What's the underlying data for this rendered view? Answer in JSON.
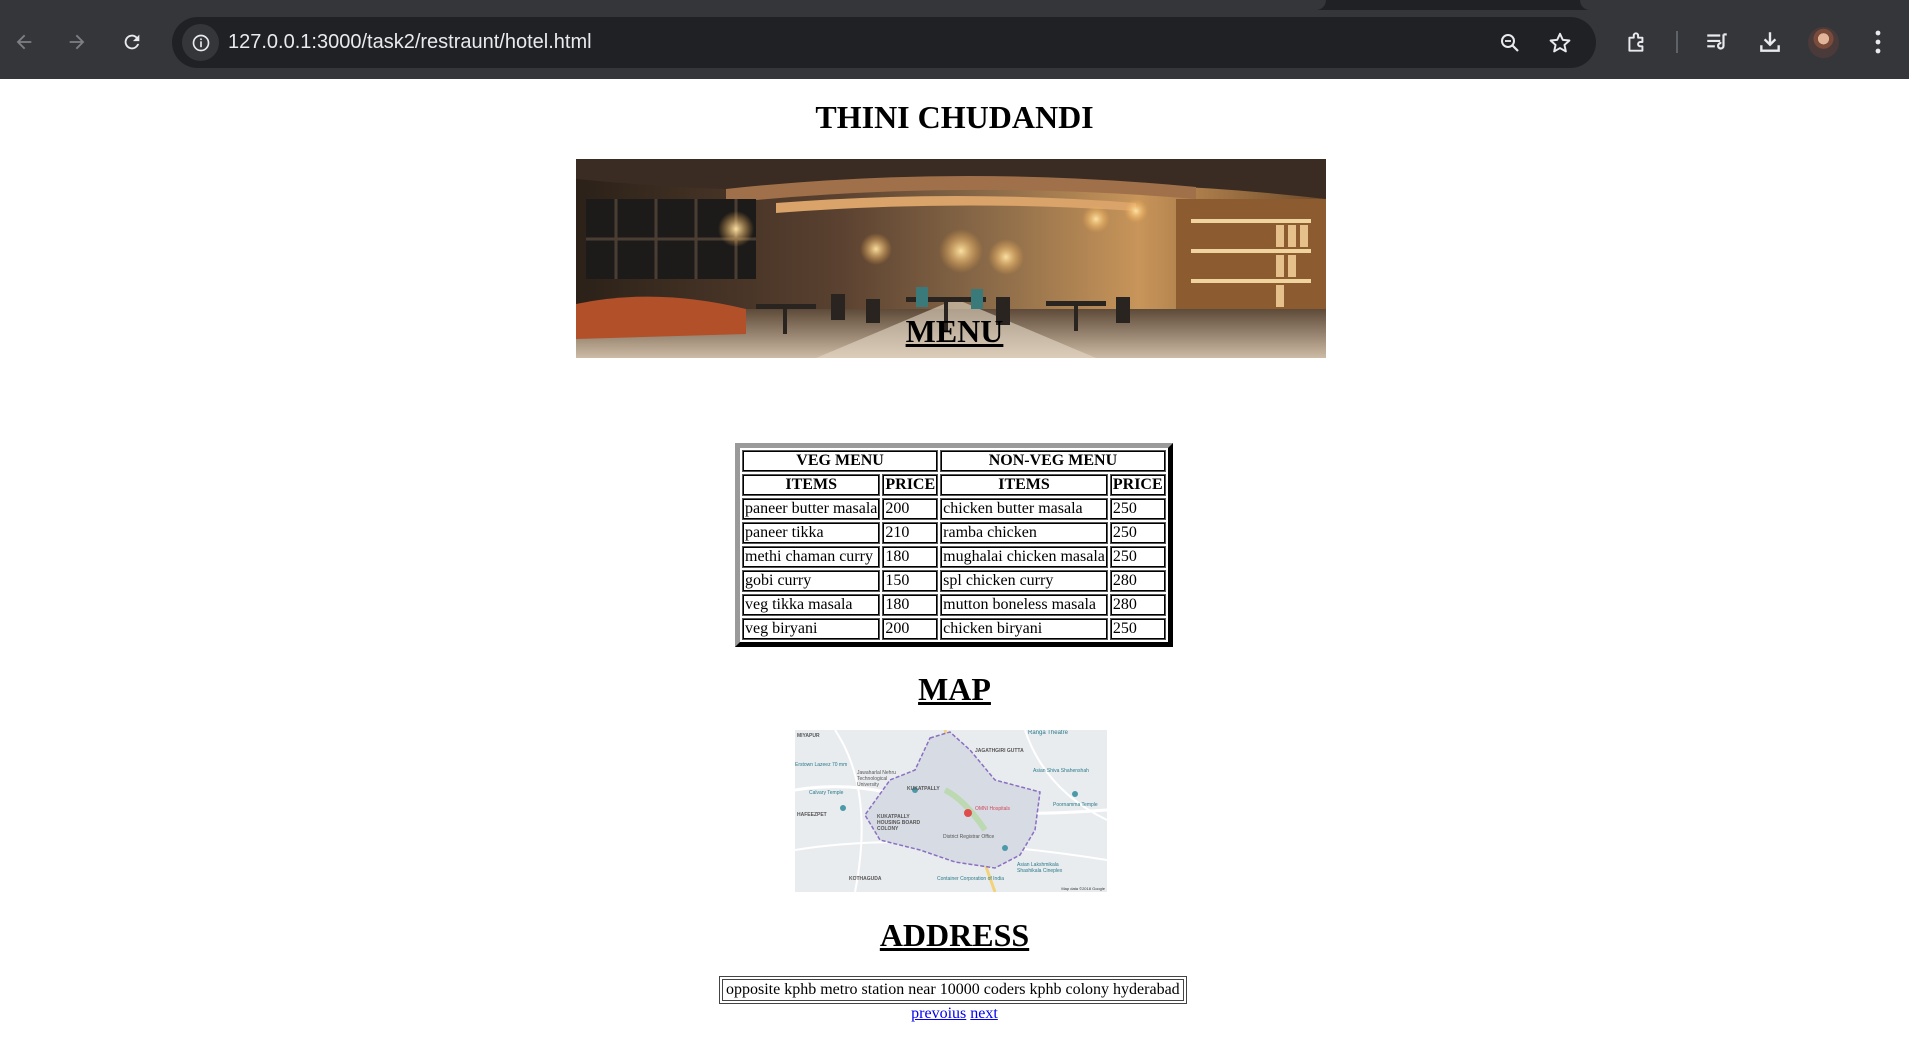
{
  "browser": {
    "url": "127.0.0.1:3000/task2/restraunt/hotel.html",
    "icons": [
      "back-arrow-icon",
      "forward-arrow-icon",
      "reload-icon",
      "site-info-icon",
      "zoom-icon",
      "bookmark-star-icon",
      "extensions-icon",
      "tab-search-icon",
      "download-icon",
      "avatar",
      "more-menu-icon"
    ]
  },
  "page": {
    "title": "THINI CHUDANDI",
    "menu_heading": "MENU",
    "map_heading": "MAP",
    "address_heading": "ADDRESS"
  },
  "menu": {
    "groups": [
      "VEG MENU",
      "NON-VEG MENU"
    ],
    "columns": [
      "ITEMS",
      "PRICE",
      "ITEMS",
      "PRICE"
    ],
    "rows": [
      {
        "veg_item": "paneer butter masala",
        "veg_price": "200",
        "nonveg_item": "chicken butter masala",
        "nonveg_price": "250"
      },
      {
        "veg_item": "paneer tikka",
        "veg_price": "210",
        "nonveg_item": "ramba chicken",
        "nonveg_price": "250"
      },
      {
        "veg_item": "methi chaman curry",
        "veg_price": "180",
        "nonveg_item": "mughalai chicken masala",
        "nonveg_price": "250"
      },
      {
        "veg_item": "gobi curry",
        "veg_price": "150",
        "nonveg_item": "spl chicken curry",
        "nonveg_price": "280"
      },
      {
        "veg_item": "veg tikka masala",
        "veg_price": "180",
        "nonveg_item": "mutton boneless masala",
        "nonveg_price": "280"
      },
      {
        "veg_item": "veg biryani",
        "veg_price": "200",
        "nonveg_item": "chicken biryani",
        "nonveg_price": "250"
      }
    ]
  },
  "map": {
    "labels": {
      "miyapur": "MIYAPUR",
      "jagathgiri": "JAGATHGIRI GUTTA",
      "ranga_theatre": "Ranga Theatre",
      "lazeez": "Erstown Lazeez 70 mm",
      "jntu": "Jawaharlal Nehru Technological University",
      "kukatpally": "KUKATPALLY",
      "asian_shiva": "Asian Shiva Shahenshah",
      "calvary": "Calvary Temple",
      "omni": "OMNI Hospitals",
      "poornamma": "Poornamma Temple",
      "hafeezpet": "HAFEEZPET",
      "housing_board": "KUKATPALLY HOUSING BOARD COLONY",
      "district_office": "District Registrar Office",
      "asian_lakshmi": "Asian Lakshmikala Shashikala Cineplex",
      "kothaguda": "KOTHAGUDA",
      "container": "Container Corporation of India",
      "credit": "Map data ©2018 Google"
    }
  },
  "address": {
    "text": "opposite kphb metro station near 10000 coders kphb colony hyderabad"
  },
  "links": {
    "previous": "prevoius",
    "next": "next"
  }
}
